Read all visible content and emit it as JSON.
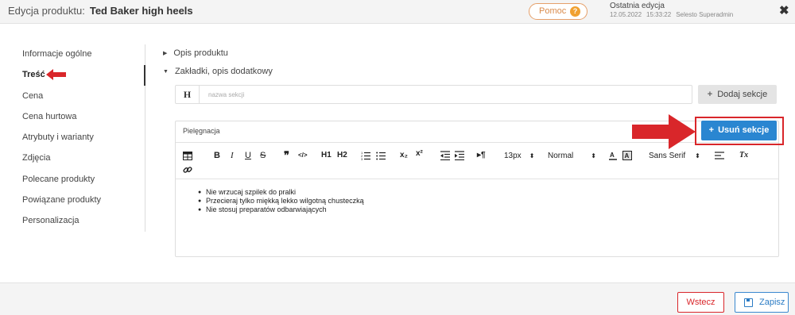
{
  "header": {
    "title_label": "Edycja produktu:",
    "product_name": "Ted Baker high heels",
    "help_label": "Pomoc",
    "help_icon": "?",
    "last_edit_label": "Ostatnia edycja",
    "last_edit_date": "12.05.2022",
    "last_edit_time": "15:33:22",
    "last_edit_user": "Selesto Superadmin",
    "close_icon": "✖"
  },
  "sidebar": {
    "items": [
      {
        "label": "Informacje ogólne"
      },
      {
        "label": "Treść"
      },
      {
        "label": "Cena"
      },
      {
        "label": "Cena hurtowa"
      },
      {
        "label": "Atrybuty i warianty"
      },
      {
        "label": "Zdjęcia"
      },
      {
        "label": "Polecane produkty"
      },
      {
        "label": "Powiązane produkty"
      },
      {
        "label": "Personalizacja"
      }
    ],
    "active_index": 1
  },
  "content": {
    "accordion_1": "Opis produktu",
    "accordion_2": "Zakładki, opis dodatkowy",
    "heading_icon": "H",
    "section_name_placeholder": "nazwa sekcji",
    "add_section_label": "Dodaj sekcje",
    "section_title": "Pielęgnacja",
    "remove_section_label": "Usuń sekcje",
    "toolbar": {
      "bold": "B",
      "italic": "I",
      "underline": "U",
      "strike": "S",
      "quote": "❞",
      "code": "</>",
      "h1": "H1",
      "h2": "H2",
      "sub": "x₂",
      "sup": "x²",
      "direction": "▸¶",
      "font_size": "13px",
      "heading": "Normal",
      "font_family": "Sans Serif",
      "clear": "Tx"
    },
    "editor_items": [
      "Nie wrzucaj szpilek do pralki",
      "Przecieraj tylko miękką lekko wilgotną chusteczką",
      "Nie stosuj preparatów odbarwiających"
    ]
  },
  "footer": {
    "back_label": "Wstecz",
    "save_label": "Zapisz"
  },
  "colors": {
    "accent_blue": "#2a86d1",
    "alert_red": "#d9262a",
    "help_orange": "#f0a030"
  }
}
